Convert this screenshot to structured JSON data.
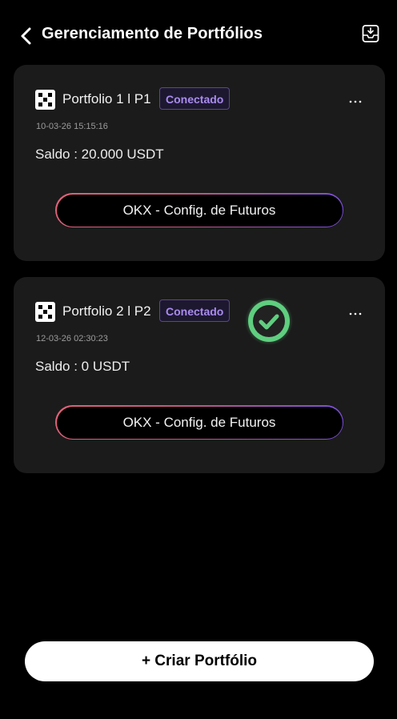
{
  "header": {
    "title": "Gerenciamento de Portfólios",
    "back_icon": "chevron-left-icon",
    "import_icon": "tray-download-icon"
  },
  "portfolios": [
    {
      "name": "Portfolio 1 l P1",
      "status": "Conectado",
      "timestamp": "10-03-26 15:15:16",
      "balance": "Saldo : 20.000 USDT",
      "action_label": "OKX - Config. de Futuros",
      "exchange_icon": "okx-logo-icon",
      "more_icon": "more-horizontal-icon"
    },
    {
      "name": "Portfolio 2 l P2",
      "status": "Conectado",
      "timestamp": "12-03-26 02:30:23",
      "balance": "Saldo : 0 USDT",
      "action_label": "OKX - Config. de Futuros",
      "exchange_icon": "okx-logo-icon",
      "more_icon": "more-horizontal-icon"
    }
  ],
  "overlay": {
    "icon": "check-circle-icon"
  },
  "footer": {
    "create_label": "+ Criar Portfólio"
  },
  "colors": {
    "background": "#000000",
    "card": "#1b1b1b",
    "badge_text": "#a98bf0",
    "gradient_start": "#e0627a",
    "gradient_end": "#7a4fd9",
    "success": "#5fce7f"
  }
}
